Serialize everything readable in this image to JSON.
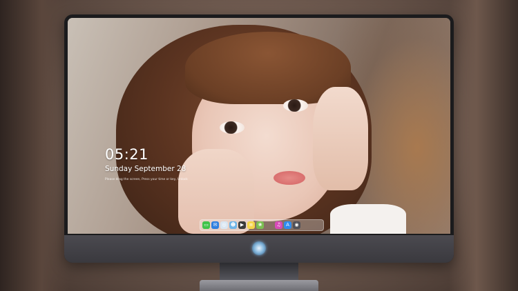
{
  "lock_screen": {
    "time": "05:21",
    "date": "Sunday September  28",
    "hint": "Please drag the screen, Press your time or key, Unlock"
  },
  "dock": {
    "items": [
      {
        "icon": "messages-icon",
        "color": "#3fc34a",
        "glyph": "▭"
      },
      {
        "icon": "mail-icon",
        "color": "#2f7fe0",
        "glyph": "✉"
      },
      {
        "icon": "safari-icon",
        "color": "#d9e6f2",
        "glyph": "◎"
      },
      {
        "icon": "finder-icon",
        "color": "#6fb5e8",
        "glyph": "☻"
      },
      {
        "icon": "video-icon",
        "color": "#3a3a3a",
        "glyph": "▶"
      },
      {
        "icon": "notes-icon",
        "color": "#f5d54a",
        "glyph": "≡"
      },
      {
        "icon": "photos-icon",
        "color": "#7cbf52",
        "glyph": "❀"
      },
      {
        "icon": "music-icon",
        "color": "#d84ab8",
        "glyph": "♫"
      },
      {
        "icon": "app-store-icon",
        "color": "#2f8cf0",
        "glyph": "A"
      },
      {
        "icon": "camera-icon",
        "color": "#505058",
        "glyph": "◉"
      }
    ]
  },
  "colors": {
    "monitor_bezel": "#1b1b1d",
    "chin": "#45444a",
    "stand": "#8e8e94"
  }
}
